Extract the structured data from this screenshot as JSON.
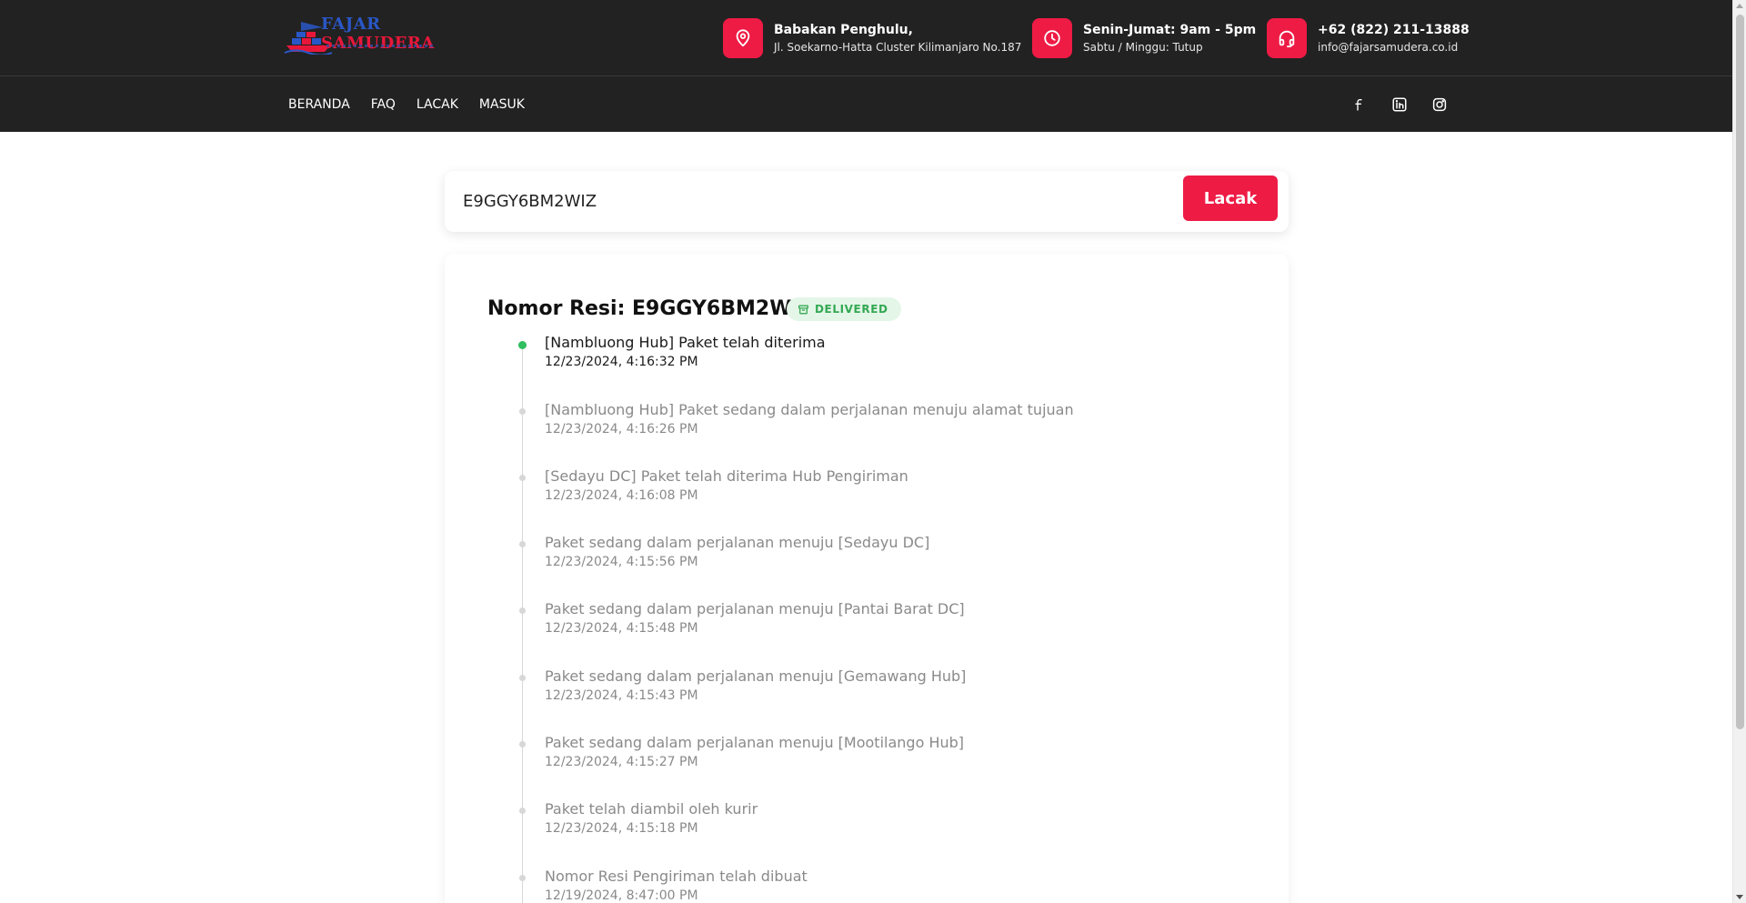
{
  "brand": {
    "name_part1": "FAJAR",
    "name_part2": "SAMUDERA",
    "primary_color": "#ee1b45",
    "dark_bg": "#222222",
    "logo_blue": "#2a57c7"
  },
  "header": {
    "address": {
      "icon": "map-pin-icon",
      "title": "Babakan Penghulu,",
      "sub": "Jl. Soekarno-Hatta Cluster Kilimanjaro No.187"
    },
    "hours": {
      "icon": "clock-icon",
      "title": "Senin-Jumat: 9am - 5pm",
      "sub": "Sabtu / Minggu: Tutup"
    },
    "contact": {
      "icon": "headset-icon",
      "title": "+62 (822) 211-13888",
      "sub": "info@fajarsamudera.co.id"
    }
  },
  "nav": {
    "items": [
      {
        "label": "BERANDA"
      },
      {
        "label": "FAQ"
      },
      {
        "label": "LACAK"
      },
      {
        "label": "MASUK"
      }
    ],
    "social": [
      "facebook-icon",
      "linkedin-icon",
      "instagram-icon"
    ]
  },
  "search": {
    "value": "E9GGY6BM2WIZ",
    "button_label": "Lacak"
  },
  "result": {
    "title": "Nomor Resi: E9GGY6BM2WIZ",
    "status": "DELIVERED",
    "status_color": "#34a853",
    "events": [
      {
        "title": "[Nambluong Hub] Paket telah diterima",
        "time": "12/23/2024, 4:16:32 PM"
      },
      {
        "title": "[Nambluong Hub] Paket sedang dalam perjalanan menuju alamat tujuan",
        "time": "12/23/2024, 4:16:26 PM"
      },
      {
        "title": "[Sedayu DC] Paket telah diterima Hub Pengiriman",
        "time": "12/23/2024, 4:16:08 PM"
      },
      {
        "title": "Paket sedang dalam perjalanan menuju [Sedayu DC]",
        "time": "12/23/2024, 4:15:56 PM"
      },
      {
        "title": "Paket sedang dalam perjalanan menuju [Pantai Barat DC]",
        "time": "12/23/2024, 4:15:48 PM"
      },
      {
        "title": "Paket sedang dalam perjalanan menuju [Gemawang Hub]",
        "time": "12/23/2024, 4:15:43 PM"
      },
      {
        "title": "Paket sedang dalam perjalanan menuju [Mootilango Hub]",
        "time": "12/23/2024, 4:15:27 PM"
      },
      {
        "title": "Paket telah diambil oleh kurir",
        "time": "12/23/2024, 4:15:18 PM"
      },
      {
        "title": "Nomor Resi Pengiriman telah dibuat",
        "time": "12/19/2024, 8:47:00 PM"
      }
    ]
  }
}
